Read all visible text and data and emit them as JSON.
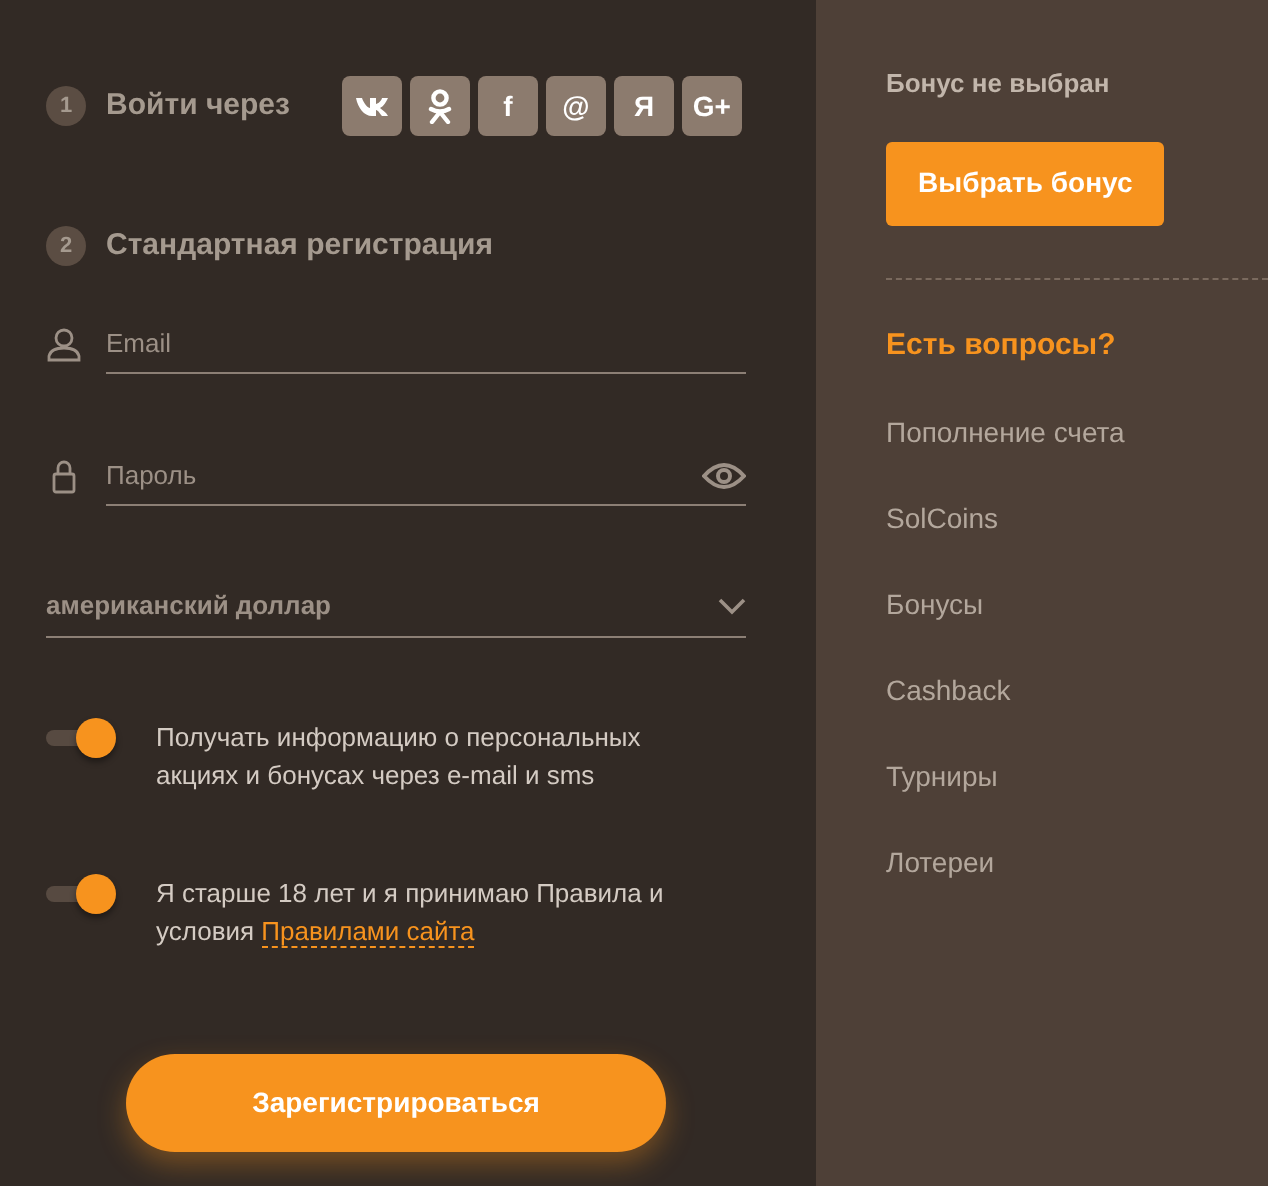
{
  "steps": [
    {
      "number": "1",
      "title": "Войти через"
    },
    {
      "number": "2",
      "title": "Стандартная регистрация"
    }
  ],
  "social": [
    {
      "kind": "vk"
    },
    {
      "kind": "ok"
    },
    {
      "kind": "text",
      "label": "f"
    },
    {
      "kind": "text",
      "label": "@"
    },
    {
      "kind": "text",
      "label": "Я"
    },
    {
      "kind": "text",
      "label": "G+"
    }
  ],
  "fields": [
    {
      "kind": "email",
      "placeholder": "Email"
    },
    {
      "kind": "password",
      "placeholder": "Пароль"
    }
  ],
  "currency": {
    "value": "американский доллар"
  },
  "toggles": [
    {
      "on": true,
      "text": "Получать информацию о персональных акциях и бонусах через e-mail и sms"
    },
    {
      "on": true,
      "text": "Я старше 18 лет и я принимаю Правила и условия",
      "link": "Правилами сайта"
    }
  ],
  "register_button": "Зарегистрироваться",
  "bonus": {
    "status": "Бонус не выбран",
    "button": "Выбрать бонус"
  },
  "help": {
    "title": "Есть вопросы?",
    "links": [
      "Пополнение счета",
      "SolCoins",
      "Бонусы",
      "Cashback",
      "Турниры",
      "Лотереи"
    ]
  }
}
